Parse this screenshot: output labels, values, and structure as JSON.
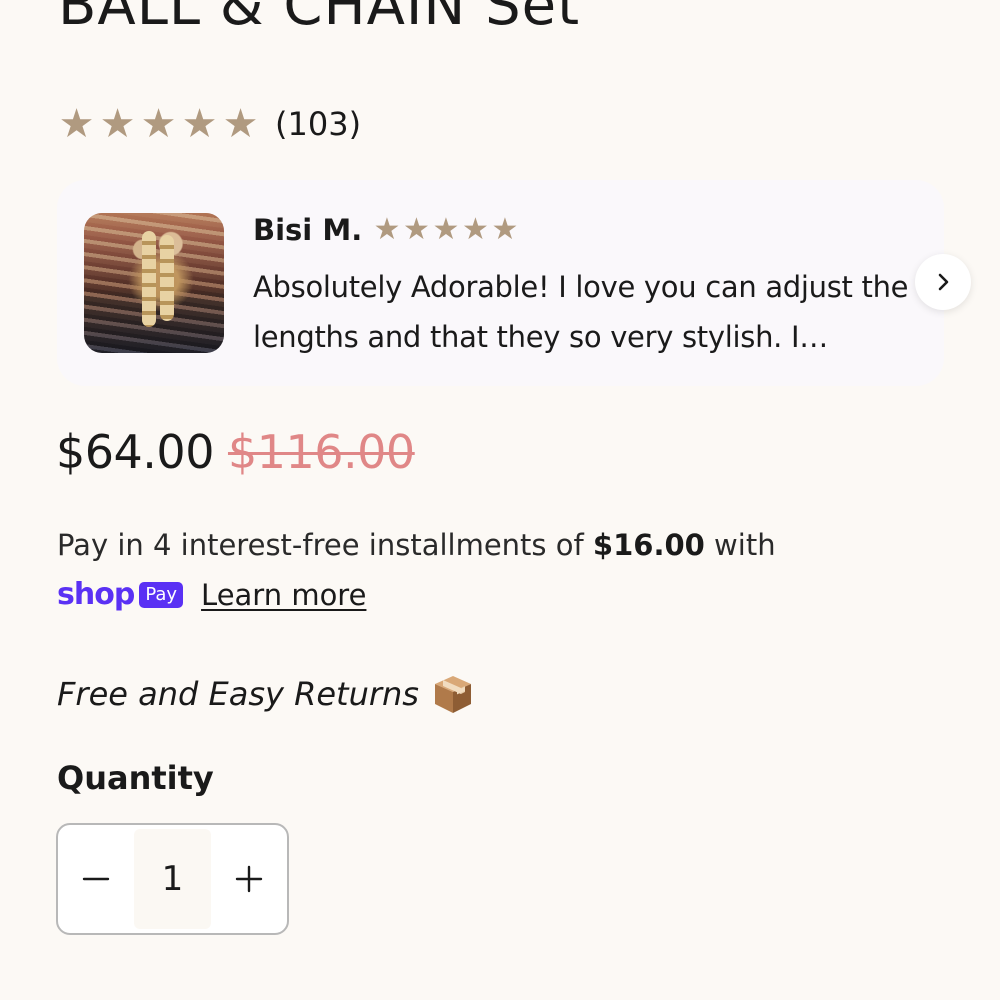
{
  "product": {
    "title": "BALL & CHAIN Set",
    "rating_stars": 5,
    "review_count": "(103)"
  },
  "review": {
    "reviewer_name": "Bisi M.",
    "stars": 5,
    "text": "Absolutely Adorable! I love you can adjust the lengths and that they so very stylish. I…",
    "next_icon": "chevron-right-icon"
  },
  "price": {
    "current": "$64.00",
    "compare_at": "$116.00"
  },
  "installments": {
    "prefix": "Pay in 4 interest-free installments of ",
    "amount": "$16.00",
    "suffix": " with",
    "shop_word": "shop",
    "pay_badge": "Pay",
    "learn_more": "Learn more"
  },
  "returns": {
    "text": "Free and Easy Returns",
    "icon": "package-box-icon"
  },
  "quantity": {
    "label": "Quantity",
    "value": "1",
    "decrease_icon": "minus-icon",
    "increase_icon": "plus-icon"
  },
  "colors": {
    "background": "#fcf9f5",
    "star": "#b09a80",
    "compare_price": "#e08787",
    "shop_pay_brand": "#5a31f4",
    "review_card_bg": "#faf8fb"
  }
}
